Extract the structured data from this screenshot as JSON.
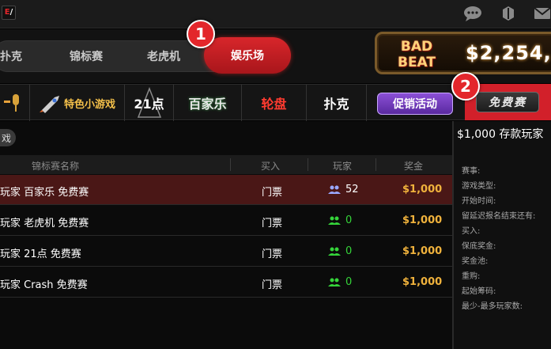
{
  "header": {
    "logo_text": "E",
    "logo_slash": "/"
  },
  "main_tabs": [
    {
      "label": "扑克"
    },
    {
      "label": "锦标赛"
    },
    {
      "label": "老虎机"
    },
    {
      "label": "娱乐场"
    }
  ],
  "badges": [
    "1",
    "2"
  ],
  "banner": {
    "logo_line1": "BAD",
    "logo_line2": "BEAT",
    "amount": "$2,254,"
  },
  "categories": [
    {
      "label": "特色小游戏"
    },
    {
      "label": "21点"
    },
    {
      "label": "百家乐"
    },
    {
      "label": "轮盘"
    },
    {
      "label": "扑克"
    },
    {
      "label": "促销活动"
    },
    {
      "label": "免费赛"
    }
  ],
  "filter_chip": "戏",
  "table": {
    "headers": [
      "锦标赛名称",
      "买入",
      "玩家",
      "奖金"
    ],
    "rows": [
      {
        "name": "玩家 百家乐 免费赛",
        "buyin": "门票",
        "players": "52",
        "prize": "$1,000",
        "selected": true
      },
      {
        "name": "玩家 老虎机 免费赛",
        "buyin": "门票",
        "players": "0",
        "prize": "$1,000"
      },
      {
        "name": "玩家 21点 免费赛",
        "buyin": "门票",
        "players": "0",
        "prize": "$1,000"
      },
      {
        "name": "玩家 Crash 免费赛",
        "buyin": "门票",
        "players": "0",
        "prize": "$1,000"
      }
    ]
  },
  "detail": {
    "title": "$1,000 存款玩家",
    "fields": [
      "赛事:",
      "游戏类型:",
      "开始时间:",
      "留延迟报名结束还有:",
      "买入:",
      "保底奖金:",
      "奖金池:",
      "重购:",
      "起始筹码:",
      "最少-最多玩家数:"
    ]
  },
  "colors": {
    "accent_red": "#d2202a",
    "prize_gold": "#f0b23c",
    "players_active": "#9aa8ff",
    "players_zero": "#35d43a",
    "selected_row": "#4a1716"
  }
}
